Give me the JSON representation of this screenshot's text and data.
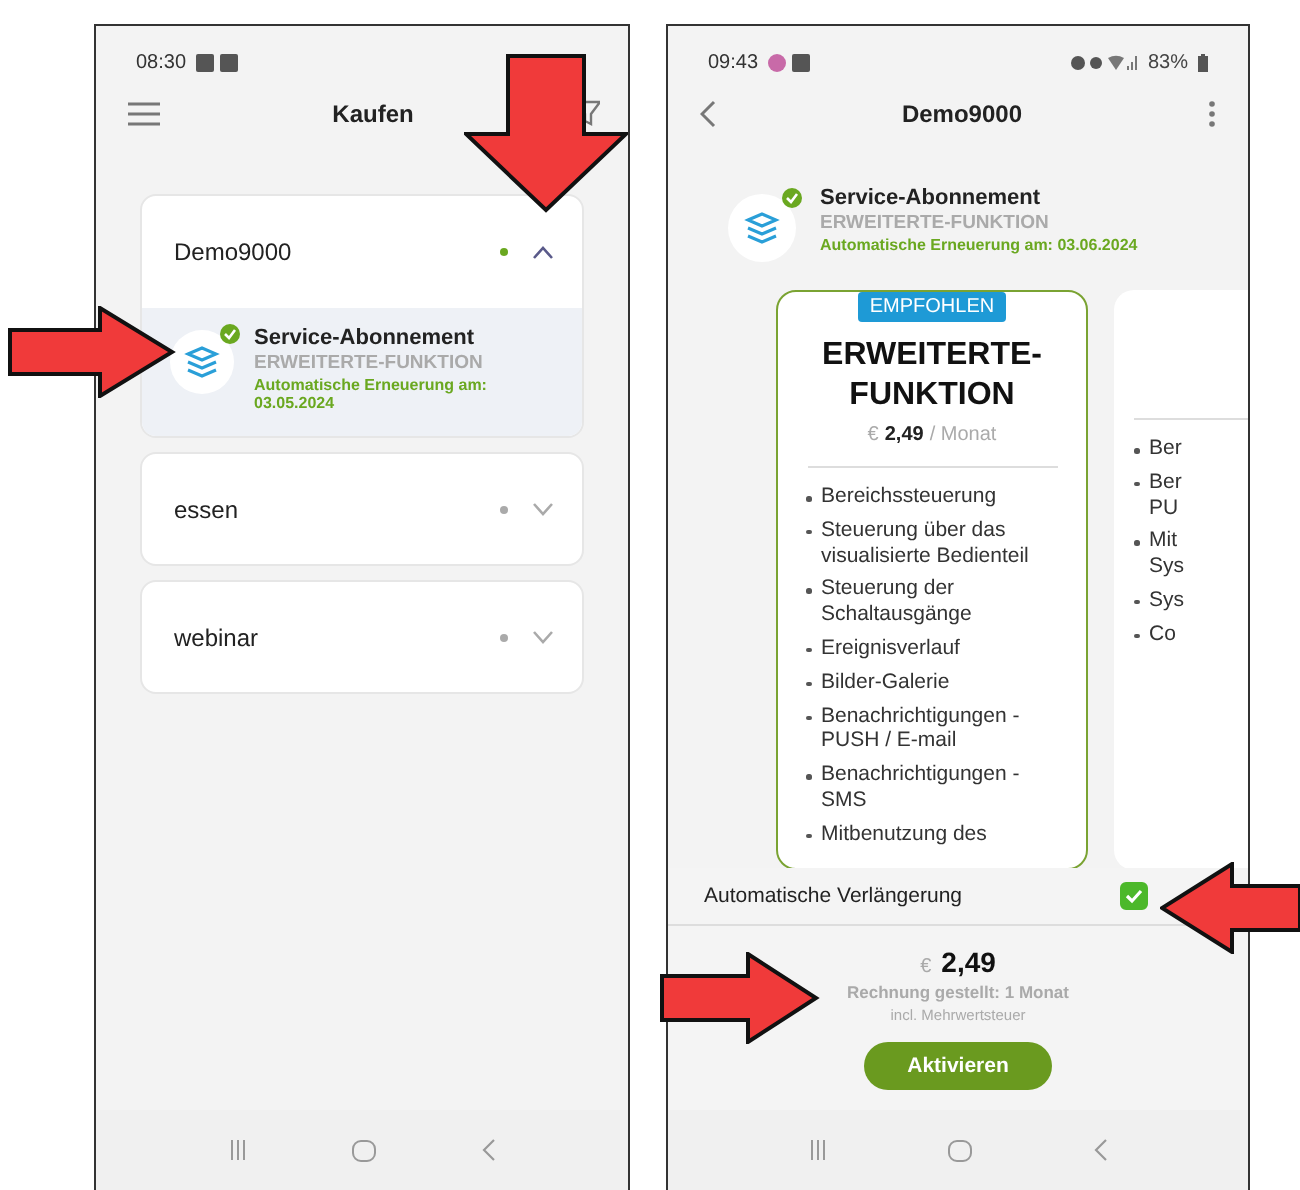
{
  "left_phone": {
    "status_bar": {
      "time": "08:30"
    },
    "header": {
      "title": "Kaufen"
    },
    "groups": [
      {
        "name": "Demo9000",
        "expanded": true,
        "active": true,
        "subscription": {
          "title": "Service-Abonnement",
          "plan": "ERWEITERTE-FUNKTION",
          "renewal": "Automatische Erneuerung am: 03.05.2024",
          "active": true
        }
      },
      {
        "name": "essen",
        "expanded": false,
        "active": false
      },
      {
        "name": "webinar",
        "expanded": false,
        "active": false
      }
    ]
  },
  "right_phone": {
    "status_bar": {
      "time": "09:43",
      "battery": "83%"
    },
    "header": {
      "title": "Demo9000"
    },
    "subscription": {
      "title": "Service-Abonnement",
      "plan": "ERWEITERTE-FUNKTION",
      "renewal": "Automatische Erneuerung am: 03.06.2024",
      "active": true
    },
    "plans": [
      {
        "badge": "EMPFOHLEN",
        "name": "ERWEITERTE-FUNKTION",
        "currency": "€",
        "price": "2,49",
        "period": "/ Monat",
        "selected": true,
        "features": [
          "Bereichssteuerung",
          "Steuerung über das visualisierte Bedienteil",
          "Steuerung der Schaltausgänge",
          "Ereignisverlauf",
          "Bilder-Galerie",
          "Benachrichtigungen - PUSH / E-mail",
          "Benachrichtigungen - SMS",
          "Mitbenutzung des"
        ]
      },
      {
        "selected": false,
        "features": [
          "Ber",
          "Ber PU",
          "Mit Sys",
          "Sys",
          "Co"
        ]
      }
    ],
    "auto_renewal": {
      "label": "Automatische Verlängerung",
      "checked": true
    },
    "summary": {
      "currency": "€",
      "price": "2,49",
      "billing": "Rechnung gestellt: 1 Monat",
      "tax": "incl. Mehrwertsteuer"
    },
    "button": "Aktivieren"
  }
}
